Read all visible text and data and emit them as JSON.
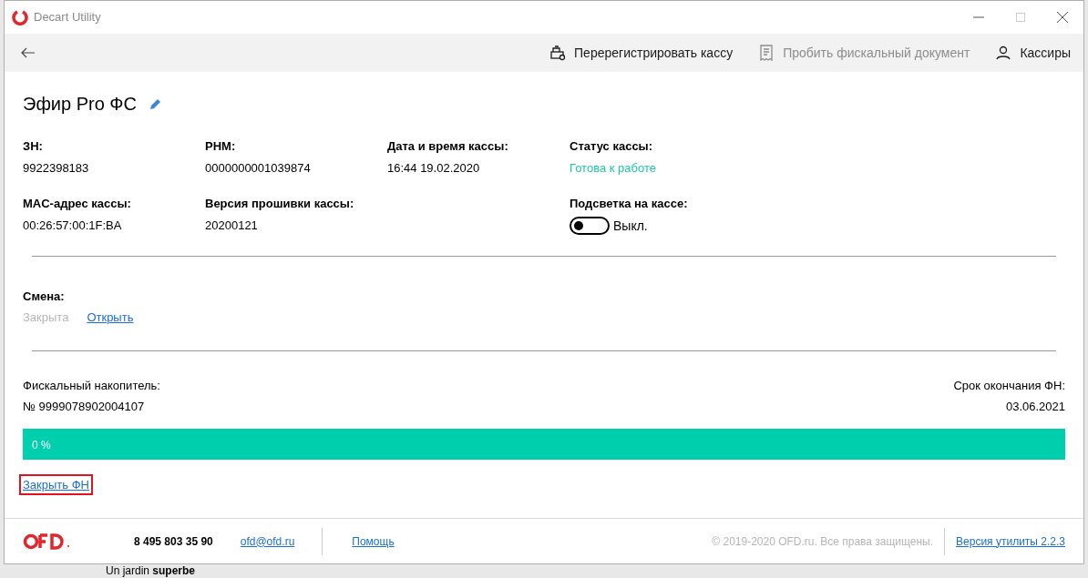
{
  "window": {
    "title": "Decart Utility"
  },
  "toolbar": [
    {
      "label": "Перерегистрировать кассу",
      "disabled": false,
      "kind": "register"
    },
    {
      "label": "Пробить фискальный документ",
      "disabled": true,
      "kind": "receipt"
    },
    {
      "label": "Кассиры",
      "disabled": false,
      "kind": "user"
    }
  ],
  "device": {
    "name": "Эфир Pro ФС"
  },
  "fields": [
    {
      "label": "ЗН:",
      "value": "9922398183",
      "kind": "text"
    },
    {
      "label": "РНМ:",
      "value": "0000000001039874",
      "kind": "text"
    },
    {
      "label": "Дата и время кассы:",
      "value": "16:44 19.02.2020",
      "kind": "text"
    },
    {
      "label": "Статус кассы:",
      "value": "Готова к работе",
      "kind": "status"
    },
    {
      "label": "MAC-адрес кассы:",
      "value": "00:26:57:00:1F:BA",
      "kind": "text"
    },
    {
      "label": "Версия прошивки кассы:",
      "value": "20200121",
      "kind": "text"
    },
    {
      "kind": "empty"
    },
    {
      "label": "Подсветка на кассе:",
      "value": "Выкл.",
      "kind": "switch",
      "on": false
    }
  ],
  "shift": {
    "label": "Смена:",
    "state": "Закрыта",
    "action": "Открыть"
  },
  "fn": {
    "label": "Фискальный накопитель:",
    "number": "№ 9999078902004107",
    "expiry_label": "Срок окончания ФН:",
    "expiry": "03.06.2021",
    "progress_text": "0 %",
    "level": 1,
    "close_link": "Закрыть ФН",
    "highlighted": true
  },
  "footer": {
    "phone": "8 495 803 35 90",
    "email": "ofd@ofd.ru",
    "help": "Помощь",
    "copyright": "© 2019-2020 OFD.ru. Все права защищены.",
    "version": "Версия утилиты 2.2.3"
  },
  "background_text": "Un jardin **superbe**"
}
